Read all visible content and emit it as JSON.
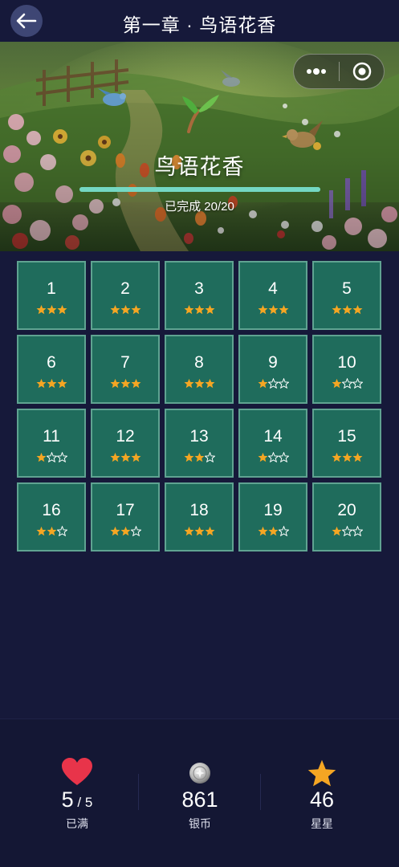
{
  "header": {
    "title": "第一章 · 鸟语花香",
    "back_icon": "arrow-left-icon"
  },
  "banner": {
    "chapter_name": "鸟语花香",
    "progress_text": "已完成 20/20",
    "progress_fraction": 1.0,
    "progress_color": "#74d8c3"
  },
  "capsule": {
    "menu_icon": "more-dots-icon",
    "close_icon": "target-circle-icon"
  },
  "levels": [
    {
      "num": "1",
      "stars": 3
    },
    {
      "num": "2",
      "stars": 3
    },
    {
      "num": "3",
      "stars": 3
    },
    {
      "num": "4",
      "stars": 3
    },
    {
      "num": "5",
      "stars": 3
    },
    {
      "num": "6",
      "stars": 3
    },
    {
      "num": "7",
      "stars": 3
    },
    {
      "num": "8",
      "stars": 3
    },
    {
      "num": "9",
      "stars": 1
    },
    {
      "num": "10",
      "stars": 1
    },
    {
      "num": "11",
      "stars": 1
    },
    {
      "num": "12",
      "stars": 3
    },
    {
      "num": "13",
      "stars": 2
    },
    {
      "num": "14",
      "stars": 1
    },
    {
      "num": "15",
      "stars": 3
    },
    {
      "num": "16",
      "stars": 2
    },
    {
      "num": "17",
      "stars": 2
    },
    {
      "num": "18",
      "stars": 3
    },
    {
      "num": "19",
      "stars": 2
    },
    {
      "num": "20",
      "stars": 1
    }
  ],
  "level_max_stars": 3,
  "colors": {
    "star_filled": "#f5a623",
    "star_empty": "#ffffff",
    "cell_bg": "#1f6c5c",
    "cell_border": "#5fa391",
    "page_bg": "#16193a"
  },
  "footer": {
    "hearts": {
      "value": "5",
      "max": "5",
      "label": "已满",
      "icon": "heart-icon"
    },
    "coins": {
      "value": "861",
      "label": "银币",
      "icon": "silver-coin-icon"
    },
    "stars": {
      "value": "46",
      "label": "星星",
      "icon": "star-icon"
    }
  }
}
